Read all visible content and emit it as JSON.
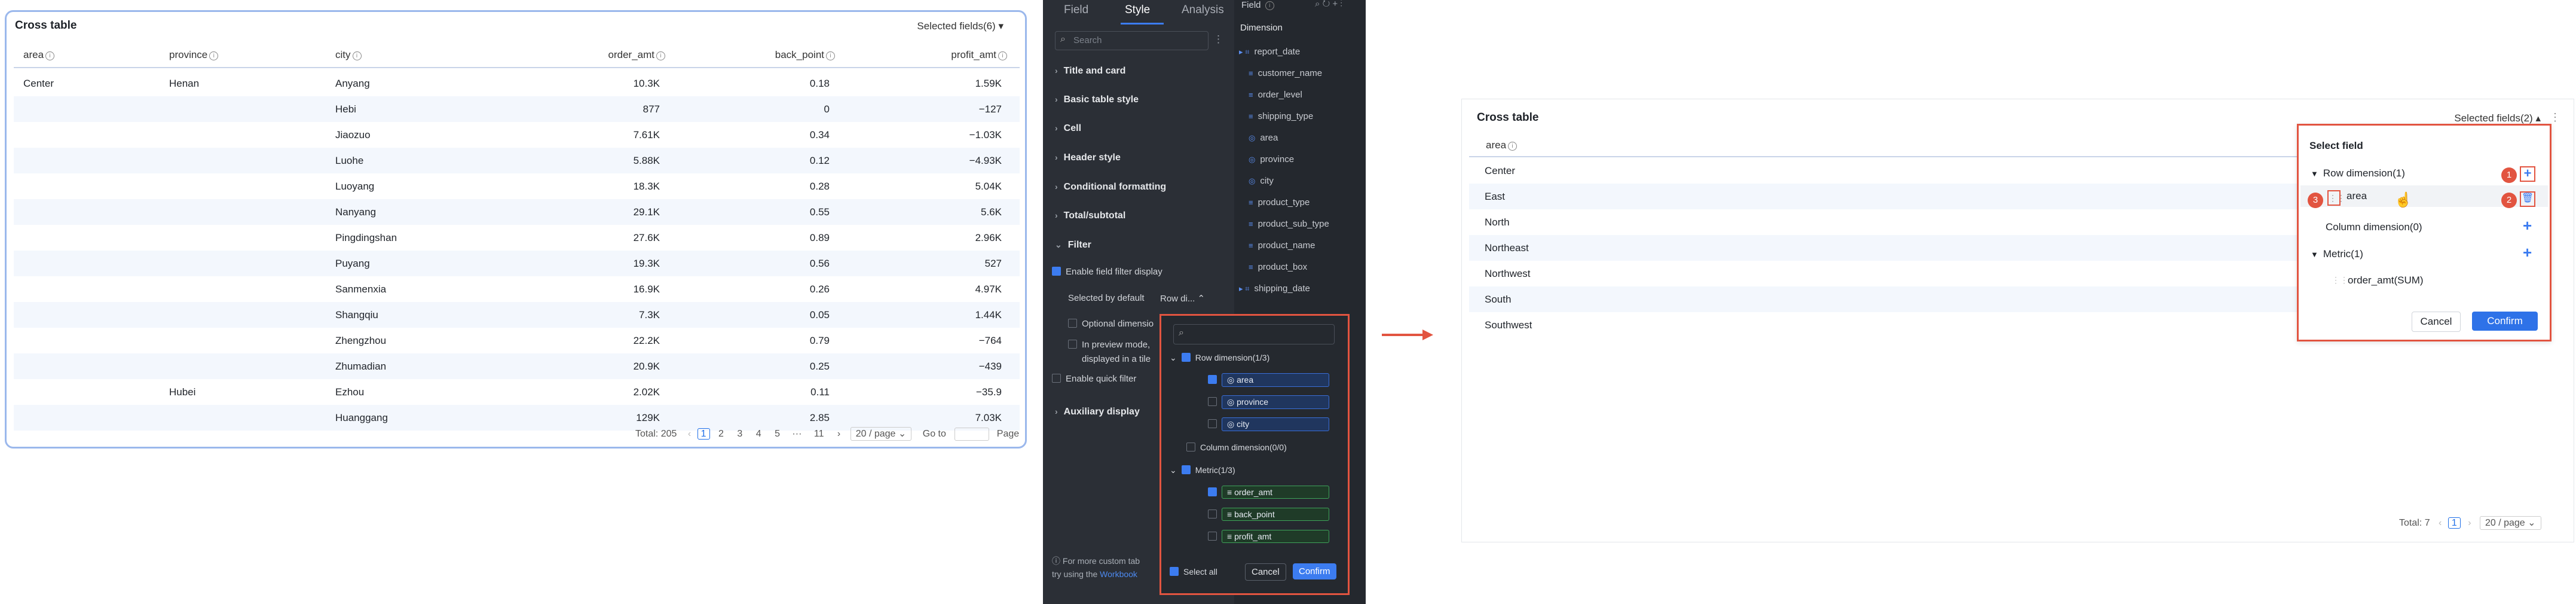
{
  "left_table": {
    "title": "Cross table",
    "selected_fields": "Selected fields(6)",
    "headers": [
      "area",
      "province",
      "city",
      "order_amt",
      "back_point",
      "profit_amt"
    ],
    "rows": [
      {
        "area": "Center",
        "province": "Henan",
        "city": "Anyang",
        "order_amt": "10.3K",
        "back_point": "0.18",
        "profit_amt": "1.59K"
      },
      {
        "area": "",
        "province": "",
        "city": "Hebi",
        "order_amt": "877",
        "back_point": "0",
        "profit_amt": "−127"
      },
      {
        "area": "",
        "province": "",
        "city": "Jiaozuo",
        "order_amt": "7.61K",
        "back_point": "0.34",
        "profit_amt": "−1.03K"
      },
      {
        "area": "",
        "province": "",
        "city": "Luohe",
        "order_amt": "5.88K",
        "back_point": "0.12",
        "profit_amt": "−4.93K"
      },
      {
        "area": "",
        "province": "",
        "city": "Luoyang",
        "order_amt": "18.3K",
        "back_point": "0.28",
        "profit_amt": "5.04K"
      },
      {
        "area": "",
        "province": "",
        "city": "Nanyang",
        "order_amt": "29.1K",
        "back_point": "0.55",
        "profit_amt": "5.6K"
      },
      {
        "area": "",
        "province": "",
        "city": "Pingdingshan",
        "order_amt": "27.6K",
        "back_point": "0.89",
        "profit_amt": "2.96K"
      },
      {
        "area": "",
        "province": "",
        "city": "Puyang",
        "order_amt": "19.3K",
        "back_point": "0.56",
        "profit_amt": "527"
      },
      {
        "area": "",
        "province": "",
        "city": "Sanmenxia",
        "order_amt": "16.9K",
        "back_point": "0.26",
        "profit_amt": "4.97K"
      },
      {
        "area": "",
        "province": "",
        "city": "Shangqiu",
        "order_amt": "7.3K",
        "back_point": "0.05",
        "profit_amt": "1.44K"
      },
      {
        "area": "",
        "province": "",
        "city": "Zhengzhou",
        "order_amt": "22.2K",
        "back_point": "0.79",
        "profit_amt": "−764"
      },
      {
        "area": "",
        "province": "",
        "city": "Zhumadian",
        "order_amt": "20.9K",
        "back_point": "0.25",
        "profit_amt": "−439"
      },
      {
        "area": "",
        "province": "Hubei",
        "city": "Ezhou",
        "order_amt": "2.02K",
        "back_point": "0.11",
        "profit_amt": "−35.9"
      },
      {
        "area": "",
        "province": "",
        "city": "Huanggang",
        "order_amt": "129K",
        "back_point": "2.85",
        "profit_amt": "7.03K"
      }
    ],
    "pager": {
      "total": "Total: 205",
      "pages": [
        "1",
        "2",
        "3",
        "4",
        "5",
        "···",
        "11"
      ],
      "per_page": "20 / page",
      "goto": "Go to",
      "page": "Page"
    }
  },
  "editor": {
    "tabs": [
      "Field",
      "Style",
      "Analysis"
    ],
    "search_placeholder": "Search",
    "sections": [
      "Title and card",
      "Basic table style",
      "Cell",
      "Header style",
      "Conditional formatting",
      "Total/subtotal"
    ],
    "filter": {
      "title": "Filter",
      "enable_filter": "Enable field filter display",
      "selected_by_default": "Selected by default",
      "row_dim_short": "Row di...",
      "optional_dimension": "Optional dimensio",
      "preview_mode_1": "In preview mode,",
      "preview_mode_2": "displayed in a tile",
      "enable_quick": "Enable quick filter"
    },
    "auxiliary": "Auxiliary display",
    "footer_1": "For more custom tab",
    "footer_2": "try using the",
    "footer_link": "Workbook"
  },
  "field_list": {
    "header": "Field",
    "dimension": "Dimension",
    "items": [
      "report_date",
      "customer_name",
      "order_level",
      "shipping_type",
      "area",
      "province",
      "city",
      "product_type",
      "product_sub_type",
      "product_name",
      "product_box",
      "shipping_date"
    ]
  },
  "popup": {
    "row_dimension": "Row dimension(1/3)",
    "row_items": [
      "area",
      "province",
      "city"
    ],
    "column_dimension": "Column dimension(0/0)",
    "metric": "Metric(1/3)",
    "metric_items": [
      "order_amt",
      "back_point",
      "profit_amt"
    ],
    "select_all": "Select all",
    "cancel": "Cancel",
    "confirm": "Confirm"
  },
  "right_table": {
    "title": "Cross table",
    "selected_fields": "Selected fields(2)",
    "header": "area",
    "rows": [
      "Center",
      "East",
      "North",
      "Northeast",
      "Northwest",
      "South",
      "Southwest"
    ],
    "pager": {
      "total": "Total: 7",
      "page": "1",
      "per_page": "20 / page"
    }
  },
  "select_panel": {
    "title": "Select field",
    "row_dimension": "Row dimension(1)",
    "area": "area",
    "column_dimension": "Column dimension(0)",
    "metric": "Metric(1)",
    "metric_item": "order_amt(SUM)",
    "cancel": "Cancel",
    "confirm": "Confirm",
    "badges": [
      "1",
      "2",
      "3"
    ]
  },
  "colors": {
    "accent": "#2e72e8",
    "highlight": "#e25440",
    "dark_bg": "#2b2f36"
  }
}
